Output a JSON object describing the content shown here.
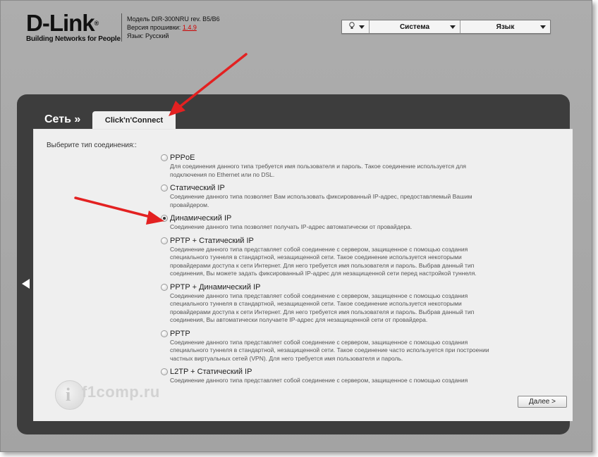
{
  "header": {
    "logo_text": "D-Link",
    "logo_reg": "®",
    "logo_tagline": "Building Networks for People",
    "model_line": "Модель DIR-300NRU rev. B5/B6",
    "firmware_label": "Версия прошивки:",
    "firmware_version": "1.4.9",
    "language_line": "Язык: Русский"
  },
  "topbar": {
    "hint_icon": "lightbulb-icon",
    "system_label": "Система",
    "language_label": "Язык"
  },
  "nav": {
    "breadcrumb": "Сеть »",
    "active_tab": "Click'n'Connect"
  },
  "form": {
    "prompt": "Выберите тип соединения::",
    "selected_index": 2,
    "options": [
      {
        "label": "PPPoE",
        "desc": "Для соединения данного типа требуется имя пользователя и пароль. Такое соединение используется для подключения по Ethernet или по DSL."
      },
      {
        "label": "Статический IP",
        "desc": "Соединение данного типа позволяет Вам использовать фиксированный IP-адрес, предоставляемый Вашим провайдером."
      },
      {
        "label": "Динамический IP",
        "desc": "Соединение данного типа позволяет получать IP-адрес автоматически от провайдера."
      },
      {
        "label": "PPTP + Статический IP",
        "desc": "Соединение данного типа представляет собой соединение с сервером, защищенное с помощью создания специального туннеля в стандартной, незащищенной сети. Такое соединение используется некоторыми провайдерами доступа к сети Интернет. Для него требуется имя пользователя и пароль. Выбрав данный тип соединения, Вы можете задать фиксированный IP-адрес для незащищенной сети перед настройкой туннеля."
      },
      {
        "label": "PPTP + Динамический IP",
        "desc": "Соединение данного типа представляет собой соединение с сервером, защищенное с помощью создания специального туннеля в стандартной, незащищенной сети. Такое соединение используется некоторыми провайдерами доступа к сети Интернет. Для него требуется имя пользователя и пароль. Выбрав данный тип соединения, Вы автоматически получаете IP-адрес для незащищенной сети от провайдера."
      },
      {
        "label": "PPTP",
        "desc": "Соединение данного типа представляет собой соединение с сервером, защищенное с помощью создания специального туннеля в стандартной, незащищенной сети. Такое соединение часто используется при построении частных виртуальных сетей (VPN). Для него требуется имя пользователя и пароль."
      },
      {
        "label": "L2TP + Статический IP",
        "desc": "Соединение данного типа представляет собой соединение с сервером, защищенное с помощью создания"
      }
    ],
    "next_button": "Далее >"
  },
  "watermark": {
    "text": "f1comp.ru"
  },
  "colors": {
    "frame_bg": "#a8a8a8",
    "panel_bg": "#3d3d3d",
    "content_bg": "#efefef",
    "annotation_arrow": "#e32121",
    "firmware_link": "#cc0000"
  }
}
